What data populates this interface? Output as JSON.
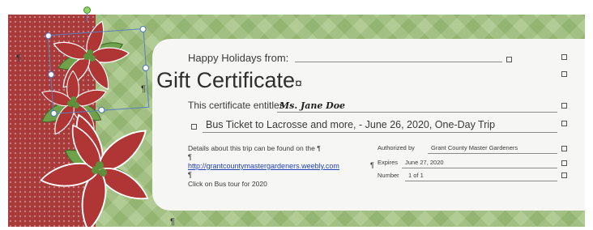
{
  "certificate": {
    "greeting": "Happy Holidays from:",
    "title": "Gift Certificate",
    "title_mark": "¤",
    "entitles_label": "This certificate entitles",
    "recipient": "Ms. Jane Doe",
    "offer": "Bus Ticket to Lacrosse and more, - June 26, 2020, One-Day Trip",
    "details_text": "Details about this trip can be found on the",
    "link": "http://grantcountymastergardeners.weebly.com",
    "footer_text": "Click on Bus tour for 2020",
    "authorized_label": "Authorized by",
    "authorized_value": "Grant County Master Gardeners",
    "expires_label": "Expires",
    "expires_value": "June 27, 2020",
    "number_label": "Number",
    "number_value": "1 of 1",
    "cell_end_mark": "¤",
    "pilcrow": "¶"
  },
  "colors": {
    "background_green": "#9ec07a",
    "band_red": "#a93a3a",
    "card": "#f6f6f4",
    "flower_red": "#b03535",
    "leaf_green": "#6fa04a",
    "link_blue": "#1f3fb5",
    "selection_blue": "#4a74c0"
  },
  "icons": {
    "decoration": "poinsettia-flowers",
    "selection_rotate_handle": "rotate-handle-icon"
  }
}
